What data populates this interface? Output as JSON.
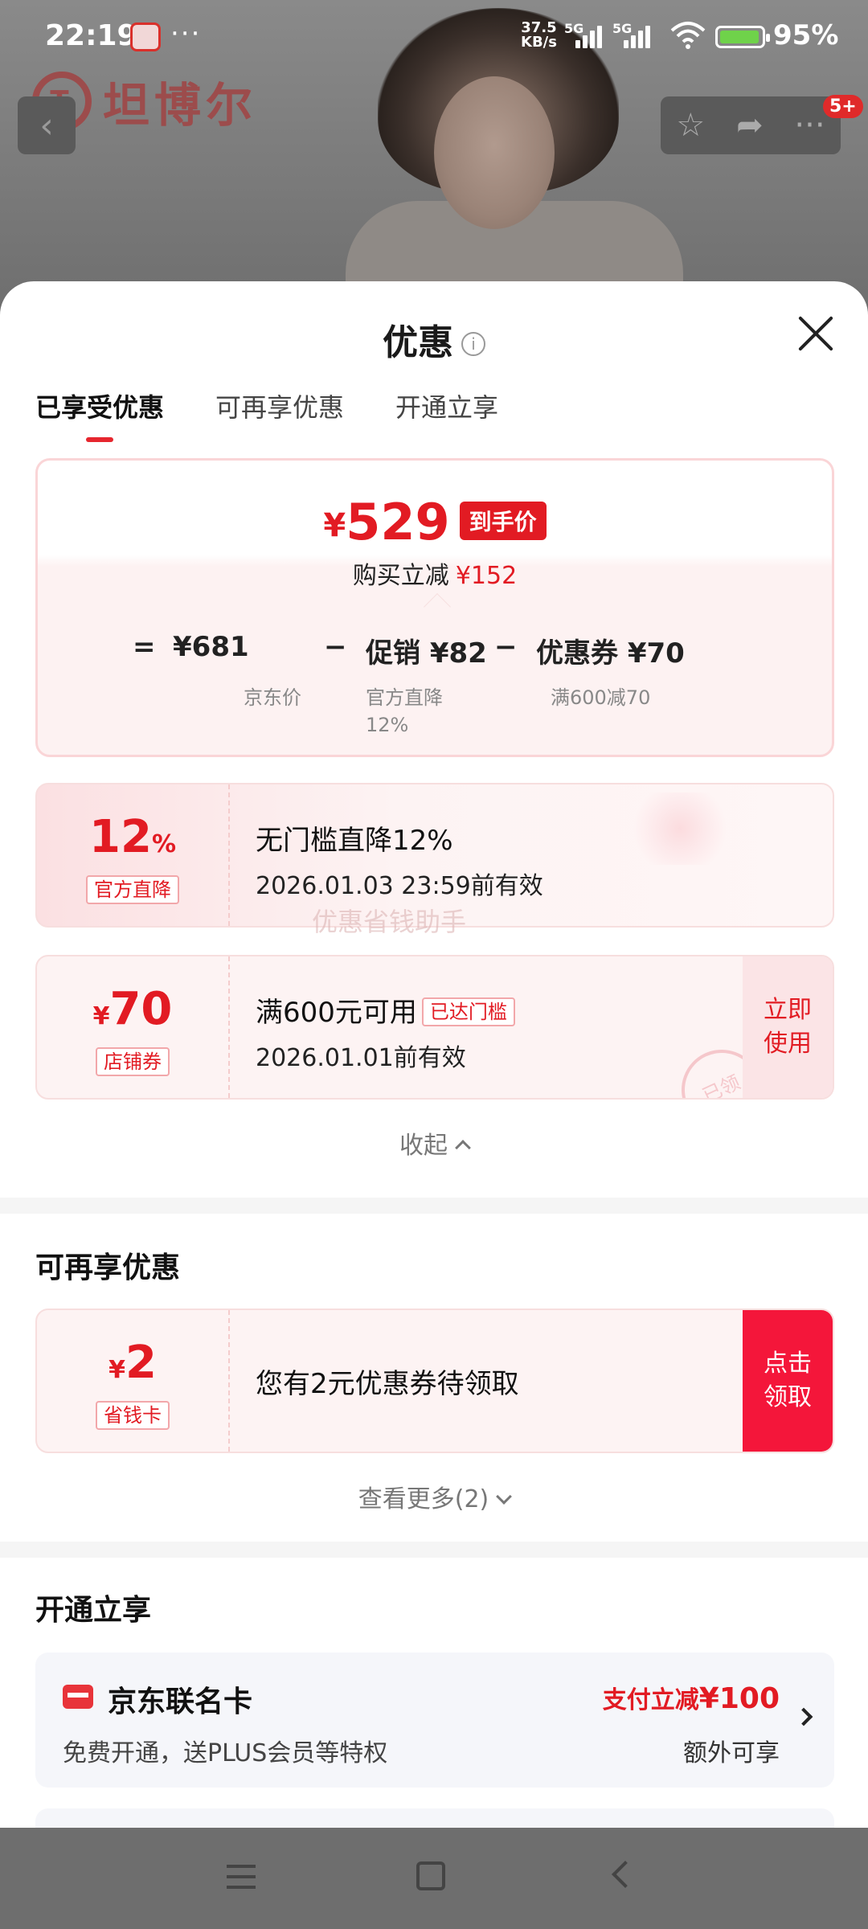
{
  "status_bar": {
    "time": "22:19",
    "dots": "···",
    "speed": "37.5\nKB/s",
    "net1": "5G",
    "net2": "5G",
    "battery": "95%"
  },
  "header": {
    "brand": "坦博尔",
    "cart_badge": "5+"
  },
  "sheet": {
    "title": "优惠",
    "tabs": [
      "已享受优惠",
      "可再享优惠",
      "开通立享"
    ],
    "summary": {
      "currency": "¥",
      "final_price": "529",
      "final_tag": "到手价",
      "reduce_label": "购买立减",
      "reduce_value": "¥152",
      "eq": "=",
      "minus": "−",
      "jd_price": "¥681",
      "jd_label": "京东价",
      "promo": "促销 ¥82",
      "promo_label_1": "官方直降",
      "promo_label_2": "12%",
      "coupon": "优惠券 ¥70",
      "coupon_label": "满600减70"
    },
    "offer_1": {
      "value": "12",
      "unit": "%",
      "tag": "官方直降",
      "line1": "无门槛直降12%",
      "line2": "2026.01.03 23:59前有效"
    },
    "watermark": "优惠省钱助手",
    "offer_2": {
      "currency": "¥",
      "value": "70",
      "tag": "店铺券",
      "line1": "满600元可用",
      "reached": "已达门槛",
      "line2": "2026.01.01前有效",
      "action": "立即\n使用",
      "stamp": "已领"
    },
    "collapse": "收起",
    "section_more": {
      "title": "可再享优惠",
      "offer": {
        "currency": "¥",
        "value": "2",
        "tag": "省钱卡",
        "line1": "您有2元优惠券待领取",
        "action": "点击\n领取"
      },
      "more": "查看更多(2)"
    },
    "section_open": {
      "title": "开通立享",
      "card": {
        "name": "京东联名卡",
        "desc": "免费开通，送PLUS会员等特权",
        "benefit_prefix": "支付立减",
        "benefit_value": "¥100",
        "benefit_note": "额外可享"
      }
    }
  }
}
